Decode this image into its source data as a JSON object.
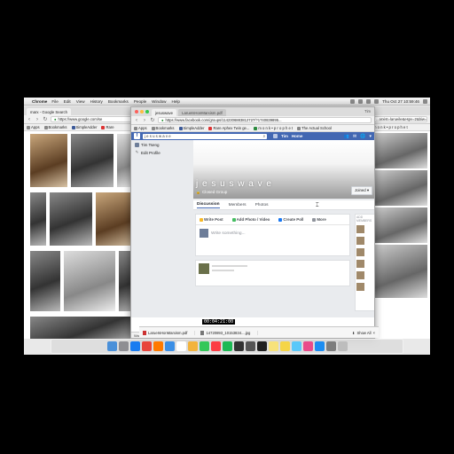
{
  "menubar": {
    "apple_glyph": "",
    "app": "Chrome",
    "items": [
      "File",
      "Edit",
      "View",
      "History",
      "Bookmarks",
      "People",
      "Window",
      "Help"
    ],
    "datetime": "Thu Oct 27  10:59:46"
  },
  "google_window": {
    "tabs": [
      "marx - Google Search"
    ],
    "url": "https://www.google.com/se",
    "bookmarks": [
      "Apps",
      "Bookmarks",
      "SimpleAdder",
      "Rare"
    ]
  },
  "fb_window": {
    "tabs": [
      "jesuswave",
      "LarueIsHonMarxism.pdf"
    ],
    "user_chip": "Tim",
    "url": "https://www.facebook.com/groups/1142306883812727/?1740839895...",
    "bookmarks": [
      "Apps",
      "Bookmarks",
      "SimpleAdder",
      "Rare Aphex Twin ge...",
      "m o n k • p r o p h e t",
      "The Actual School"
    ],
    "header": {
      "logo": "f",
      "search_value": "j e s u s w a v e",
      "nav_user": "Tim",
      "nav_home": "Home"
    },
    "left_nav": [
      "Tim Tseng",
      "Edit Profile"
    ],
    "group": {
      "title": "j e s u s w a v e",
      "type": "Closed Group",
      "joined_label": "Joined ▾"
    },
    "tabs_nav": [
      "Discussion",
      "Members",
      "Photos"
    ],
    "composer": {
      "actions": [
        "Write Post",
        "Add Photo / Video",
        "Create Poll",
        "More"
      ],
      "placeholder": "Write something..."
    },
    "right_col_head": "ADD MEMBERS",
    "status": "Waiting for 6-edge-chat.facebook.com...",
    "video_time": "00:04:21:00"
  },
  "right_window": {
    "url": "...arxist=larueile&espv=2&biw=",
    "bookmarks": "m o n k • p r o p h e t"
  },
  "downloads": {
    "items": [
      "LarueIsHonMarxism.pdf",
      "14720893_10153834....jpg"
    ],
    "show_all": "Show All"
  },
  "colors": {
    "facebook_blue": "#4267b2",
    "menubar": "#e9e9e9",
    "dock_tint": "#dcdcdc"
  },
  "dock_apps": [
    "finder",
    "launchpad",
    "safari",
    "chrome",
    "firefox",
    "mail",
    "calendar",
    "photos",
    "messages",
    "music",
    "spotify",
    "app5",
    "app7",
    "live",
    "stickies",
    "notes",
    "preview",
    "itunes",
    "app-store",
    "system-prefs",
    "trash"
  ]
}
